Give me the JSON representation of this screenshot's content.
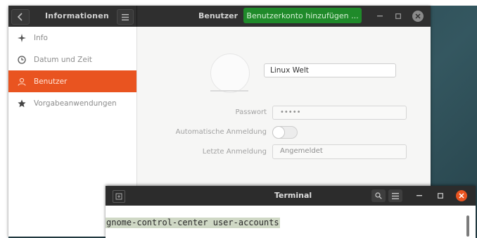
{
  "settings": {
    "sidebar_title": "Informationen",
    "page_title": "Benutzer",
    "add_account_label": "Benutzerkonto hinzufügen ...",
    "sidebar": {
      "items": [
        {
          "label": "Info",
          "icon": "sparkle-icon",
          "active": false
        },
        {
          "label": "Datum und Zeit",
          "icon": "clock-icon",
          "active": false
        },
        {
          "label": "Benutzer",
          "icon": "user-icon",
          "active": true
        },
        {
          "label": "Vorgabeanwendungen",
          "icon": "star-icon",
          "active": false
        }
      ]
    },
    "user": {
      "name": "Linux Welt",
      "password_label": "Passwort",
      "password_value": "•••••",
      "autologin_label": "Automatische Anmeldung",
      "autologin_enabled": false,
      "last_login_label": "Letzte Anmeldung",
      "last_login_value": "Angemeldet"
    }
  },
  "terminal": {
    "title": "Terminal",
    "command": "gnome-control-center user-accounts"
  },
  "colors": {
    "accent": "#e95420",
    "add_button": "#1f8a2a",
    "titlebar": "#2f2f2f"
  }
}
